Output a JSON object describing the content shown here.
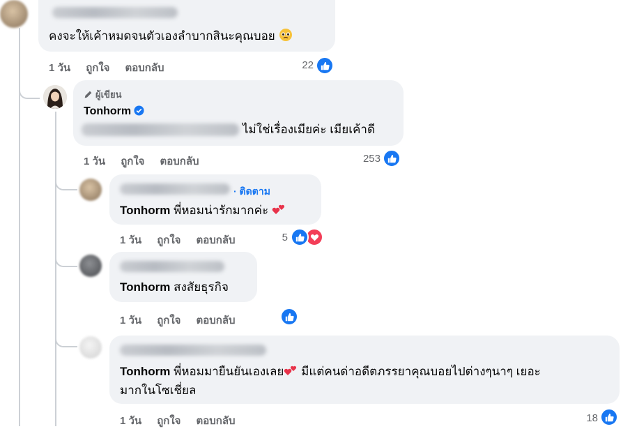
{
  "comment1": {
    "text": "คงจะให้เค้าหมดจนตัวเองลำบากสินะคุณบอย",
    "time": "1 วัน",
    "like_label": "ถูกใจ",
    "reply_label": "ตอบกลับ",
    "reaction_count": "22"
  },
  "reply1": {
    "author_badge": "ผู้เขียน",
    "author": "Tonhorm",
    "text": "ไม่ใช่เรื่องเมียค่ะ เมียเค้าดี",
    "time": "1 วัน",
    "like_label": "ถูกใจ",
    "reply_label": "ตอบกลับ",
    "reaction_count": "253"
  },
  "reply2": {
    "follow_label": "· ติดตาม",
    "mention": "Tonhorm",
    "text": "พี่หอมน่ารักมากค่ะ",
    "time": "1 วัน",
    "like_label": "ถูกใจ",
    "reply_label": "ตอบกลับ",
    "reaction_count": "5"
  },
  "reply3": {
    "mention": "Tonhorm",
    "text": "สงสัยธุรกิจ",
    "time": "1 วัน",
    "like_label": "ถูกใจ",
    "reply_label": "ตอบกลับ"
  },
  "reply4": {
    "mention": "Tonhorm",
    "text_line1": "พี่หอมมายืนยันเองเลย",
    "text_line1b": "มีแต่คนด่าอดีตภรรยาคุณบอยไปต่างๆนาๆ เยอะ",
    "text_line2": "มากในโซเชี่ยล",
    "time": "1 วัน",
    "like_label": "ถูกใจ",
    "reply_label": "ตอบกลับ",
    "reaction_count": "18"
  },
  "colors": {
    "accent": "#1877f2",
    "bubble": "#f0f2f5",
    "secondary_text": "#65676b",
    "love": "#f33e58"
  }
}
